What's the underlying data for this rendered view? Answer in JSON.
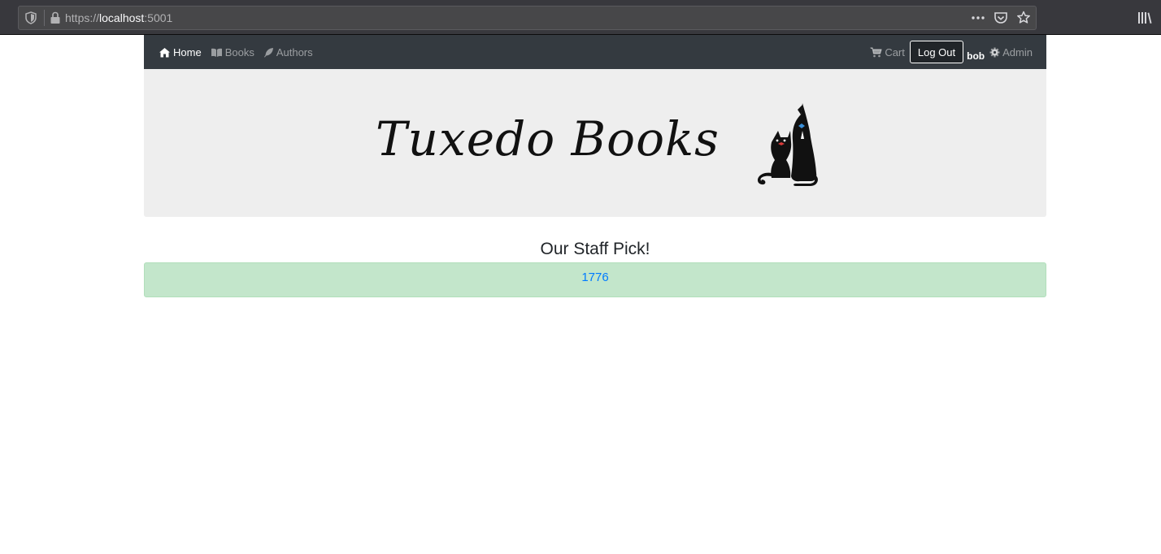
{
  "browser": {
    "url_scheme": "https://",
    "url_host": "localhost",
    "url_port": ":5001",
    "icons": [
      "shield-icon",
      "lock-icon",
      "more-icon",
      "pocket-icon",
      "star-icon",
      "library-icon"
    ]
  },
  "navbar": {
    "home_label": "Home",
    "books_label": "Books",
    "authors_label": "Authors",
    "cart_label": "Cart",
    "logout_label": "Log Out",
    "username": "bob",
    "admin_label": "Admin",
    "colors": {
      "background": "#343a40",
      "active": "#ffffff",
      "inactive": "rgba(255,255,255,0.5)"
    }
  },
  "banner": {
    "title": "Tuxedo Books",
    "background": "#eeeeee"
  },
  "main": {
    "staff_pick_heading": "Our Staff Pick!",
    "staff_pick_book": "1776",
    "pick_background": "#c3e6cb",
    "link_color": "#007bff"
  }
}
